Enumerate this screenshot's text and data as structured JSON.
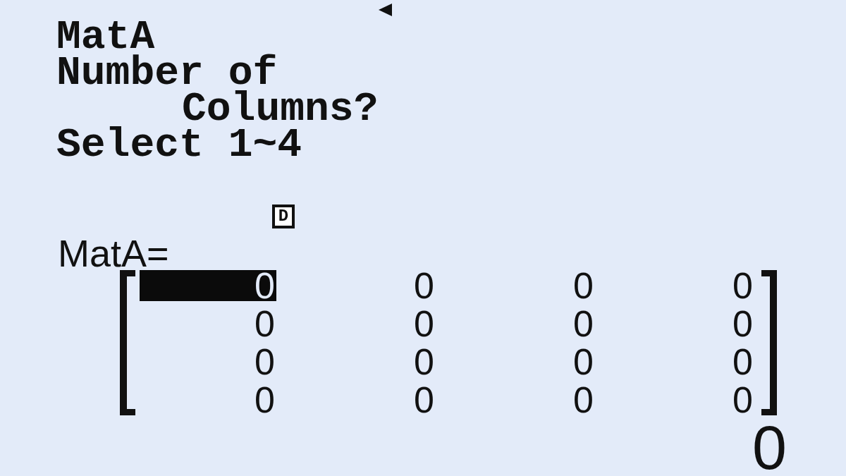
{
  "prompt": {
    "title": "MatA",
    "question": [
      "Number of",
      "Columns?"
    ],
    "hint": "Select 1~4"
  },
  "angle_mode": "D",
  "matrix": {
    "label": "MatA=",
    "rows": [
      {
        "cells": [
          {
            "value": "0",
            "selected": true
          },
          {
            "value": "0",
            "selected": false
          },
          {
            "value": "0",
            "selected": false
          },
          {
            "value": "0",
            "selected": false
          }
        ]
      },
      {
        "cells": [
          {
            "value": "0",
            "selected": false
          },
          {
            "value": "0",
            "selected": false
          },
          {
            "value": "0",
            "selected": false
          },
          {
            "value": "0",
            "selected": false
          }
        ]
      },
      {
        "cells": [
          {
            "value": "0",
            "selected": false
          },
          {
            "value": "0",
            "selected": false
          },
          {
            "value": "0",
            "selected": false
          },
          {
            "value": "0",
            "selected": false
          }
        ]
      },
      {
        "cells": [
          {
            "value": "0",
            "selected": false
          },
          {
            "value": "0",
            "selected": false
          },
          {
            "value": "0",
            "selected": false
          },
          {
            "value": "0",
            "selected": false
          }
        ]
      }
    ]
  },
  "entry": "0"
}
